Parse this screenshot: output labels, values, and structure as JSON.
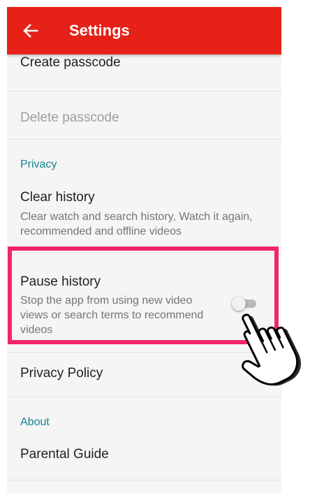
{
  "appbar": {
    "title": "Settings",
    "back_icon": "arrow-left-icon"
  },
  "rows": {
    "create_passcode": "Create passcode",
    "delete_passcode": "Delete passcode",
    "privacy_header": "Privacy",
    "clear_history": {
      "title": "Clear history",
      "subtitle": "Clear watch and search history, Watch it again, recommended and offline videos"
    },
    "pause_history": {
      "title": "Pause history",
      "subtitle": "Stop the app from using new video views or search terms to recommend videos",
      "toggle_on": false
    },
    "privacy_policy": "Privacy Policy",
    "about_header": "About",
    "parental_guide": "Parental Guide"
  },
  "colors": {
    "appbar": "#e62117",
    "section_header": "#11868e",
    "highlight": "#f0266a"
  },
  "overlay": {
    "highlight": "annotation-highlight-box",
    "pointer_icon": "hand-pointer-icon"
  }
}
